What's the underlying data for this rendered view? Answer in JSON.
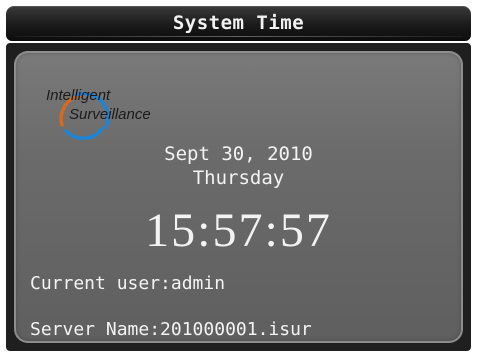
{
  "titlebar": {
    "title": "System Time"
  },
  "logo": {
    "line1": "Intelligent",
    "line2": "Surveillance",
    "ring_colors": [
      "#d36a1f",
      "#1e84d4"
    ]
  },
  "datetime": {
    "date": "Sept 30, 2010",
    "weekday": "Thursday",
    "time": "15:57:57"
  },
  "info": {
    "current_user": "Current user:admin",
    "server_name": "Server Name:201000001.isur"
  },
  "colors": {
    "titlebar_bg": "#111111",
    "panel_bg": "#6b6b6b",
    "text": "#f3f3f3"
  }
}
